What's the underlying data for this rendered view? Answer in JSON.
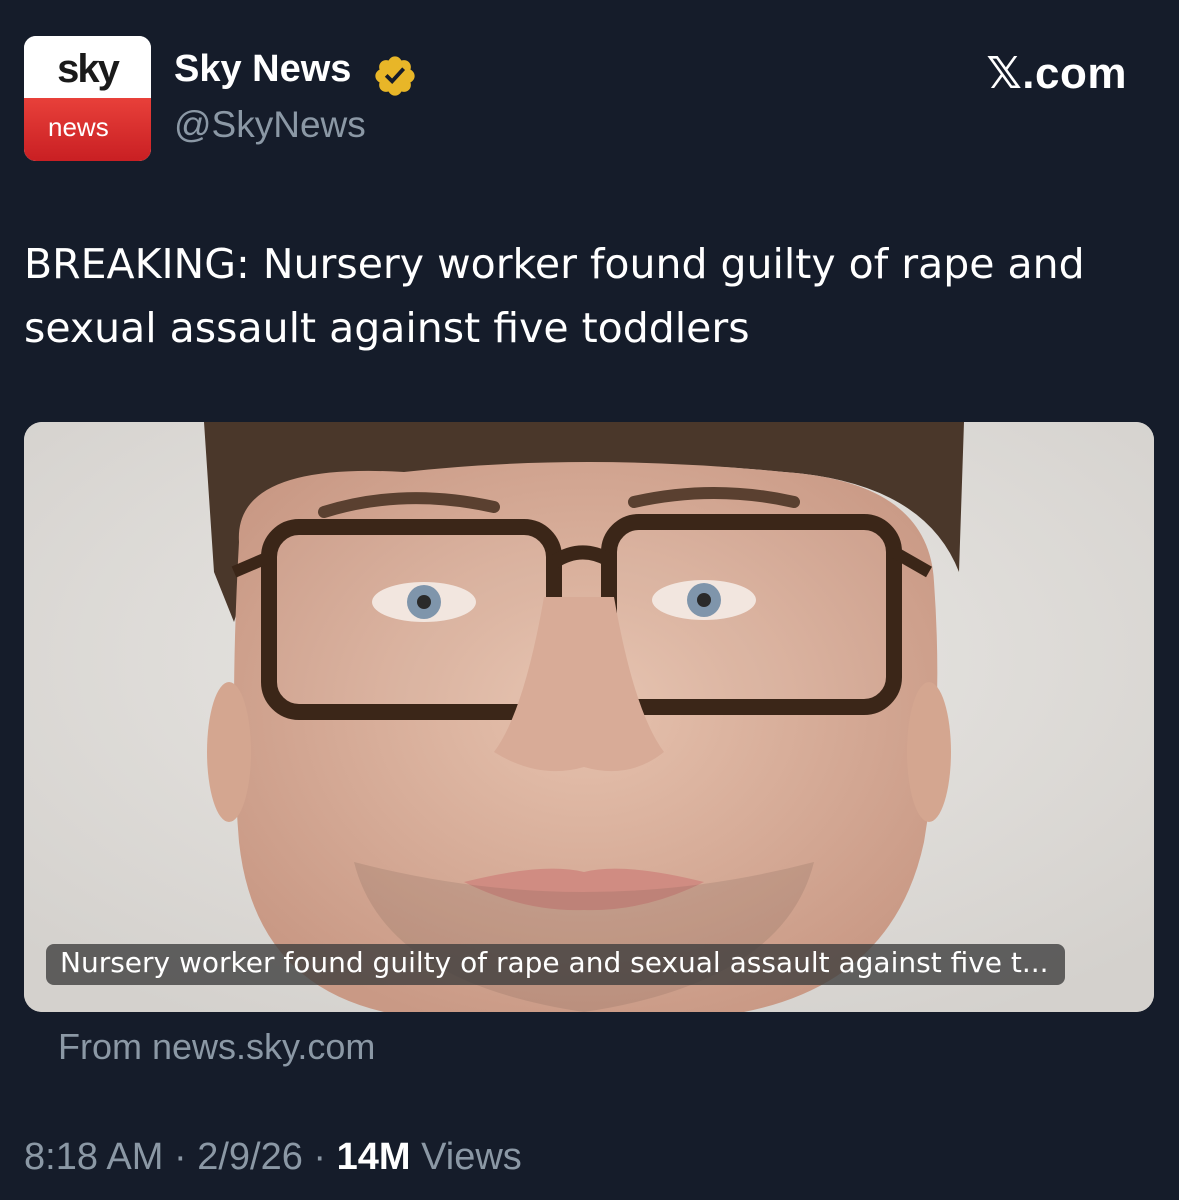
{
  "header": {
    "avatar": {
      "top_text": "sky",
      "bottom_text": "news",
      "colors": {
        "top": "#ffffff",
        "bottom": "#d62b2b"
      }
    },
    "display_name": "Sky News",
    "verified_badge": {
      "icon": "verified-badge-icon",
      "color": "#e8b628"
    },
    "handle": "@SkyNews",
    "source_site": {
      "x_mark": "𝕏",
      "domain": ".com"
    }
  },
  "post": {
    "text": "BREAKING: Nursery worker found guilty of rape and sexual assault against five toddlers"
  },
  "card": {
    "image": {
      "description_icon": "person-photo"
    },
    "caption": "Nursery worker found guilty of rape and sexual assault against five t...",
    "source": "From news.sky.com"
  },
  "meta": {
    "time": "8:18 AM",
    "separator": " · ",
    "date": "2/9/26",
    "views_count": "14M",
    "views_label": " Views"
  },
  "colors": {
    "background": "#151c2a",
    "primary_text": "#ffffff",
    "secondary_text": "#8b98a5"
  }
}
